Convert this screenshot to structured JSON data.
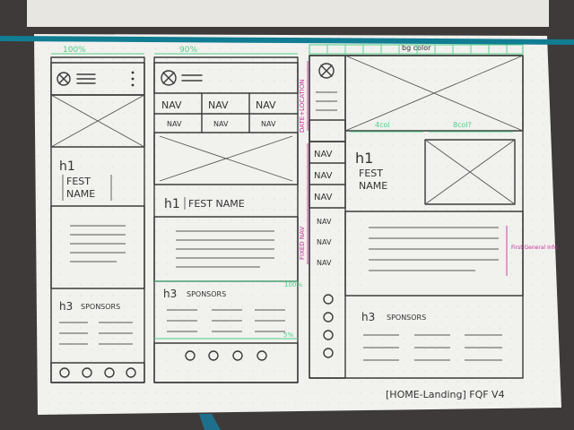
{
  "colors": {
    "desk": "#3d3a39",
    "paper": "#f1f1ee",
    "ink": "#3a3a3a",
    "green_marker": "#4fcf8a",
    "magenta_marker": "#c4339a",
    "ribbon": "#117d93"
  },
  "annotations": {
    "width_full": "100%",
    "width_mid": "90%",
    "bg_color": "bg color",
    "date_location": "DATE+LOCATION",
    "fixed_nav": "FIXED NAV",
    "col_left": "4col",
    "col_right": "8col?",
    "width_bottom_mid": "100%",
    "width_bottom_small": "5%",
    "first_general_info": "First General Info"
  },
  "mobile": {
    "heading": "h1",
    "title_line1": "FEST",
    "title_line2": "NAME",
    "sponsors_heading": "h3",
    "sponsors_label": "SPONSORS"
  },
  "tablet": {
    "nav_items": [
      "NAV",
      "NAV",
      "NAV"
    ],
    "subnav_items": [
      "NAV",
      "NAV",
      "NAV"
    ],
    "heading": "h1",
    "title": "FEST NAME",
    "sponsors_heading": "h3",
    "sponsors_label": "SPONSORS"
  },
  "desktop": {
    "nav_items": [
      "NAV",
      "NAV",
      "NAV",
      "NAV",
      "NAV",
      "NAV"
    ],
    "heading": "h1",
    "title_line1": "FEST",
    "title_line2": "NAME",
    "sponsors_heading": "h3",
    "sponsors_label": "SPONSORS"
  },
  "footer_caption": "[HOME-Landing] FQF V4"
}
